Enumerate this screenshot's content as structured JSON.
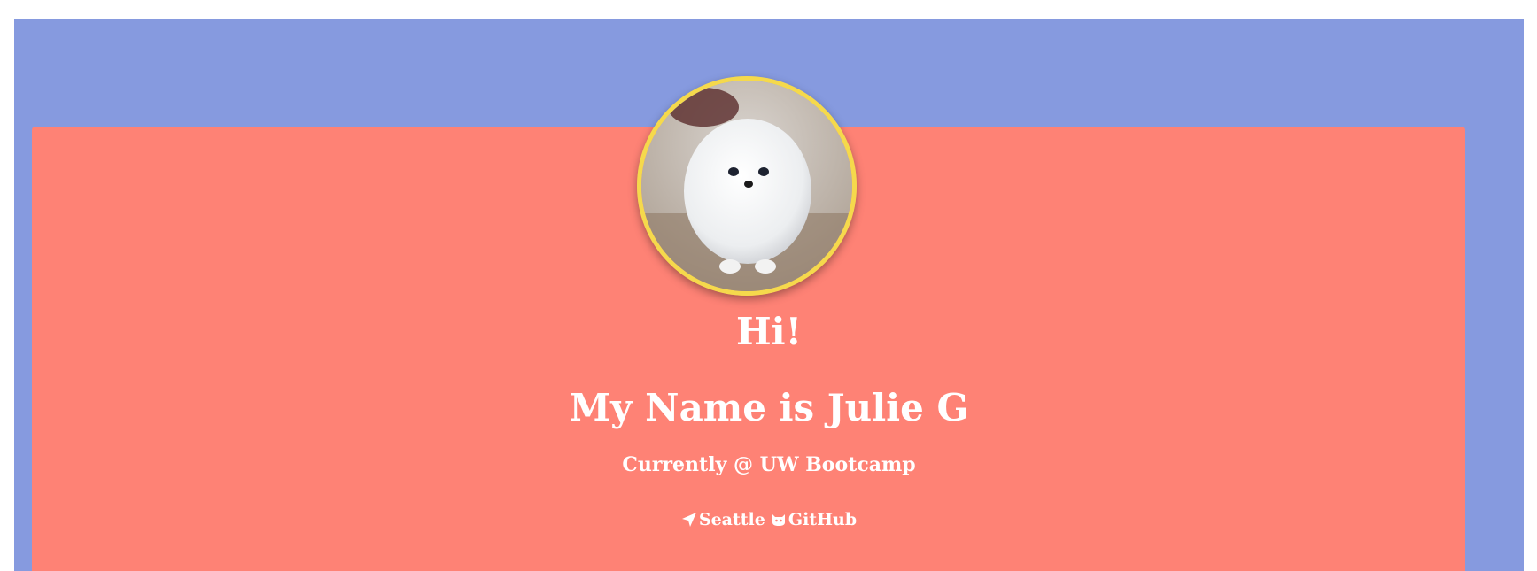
{
  "hero": {
    "greeting": "Hi!",
    "name": "My Name is Julie G",
    "status": "Currently @ UW Bootcamp"
  },
  "links": {
    "location_label": "Seattle",
    "location_icon": "location-arrow-icon",
    "github_label": "GitHub",
    "github_icon": "github-icon"
  },
  "colors": {
    "page_background": "#869adf",
    "card_background": "#fe8275",
    "avatar_border": "#f5d94c",
    "text": "#ffffff"
  }
}
